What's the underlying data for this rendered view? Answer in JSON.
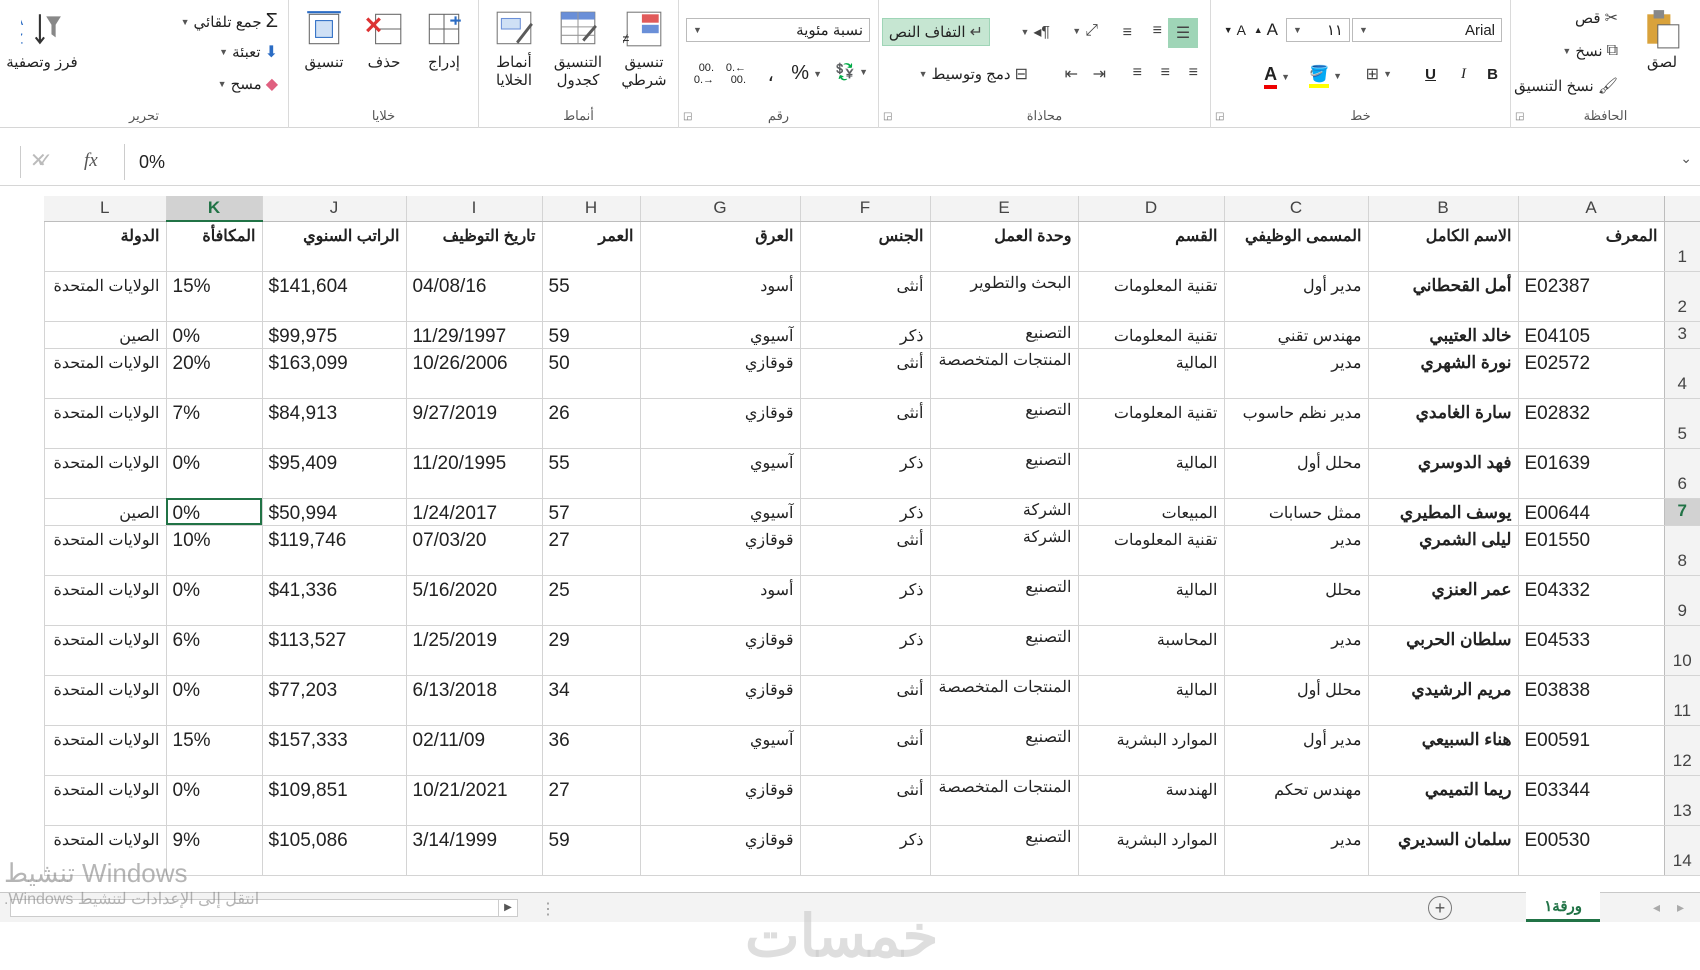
{
  "ribbon": {
    "clipboard": {
      "paste": "لصق",
      "cut": "قص",
      "copy": "نسخ",
      "format_painter": "نسخ التنسيق",
      "title": "الحافظة"
    },
    "font": {
      "name": "Arial",
      "size": "١١",
      "title": "خط",
      "bold": "B",
      "italic": "I",
      "underline": "U",
      "font_color_letter": "A"
    },
    "alignment": {
      "wrap_text": "التفاف النص",
      "merge_center": "دمج وتوسيط",
      "title": "محاذاة"
    },
    "number": {
      "format": "نسبة مئوية",
      "percent": "%",
      "comma": "،",
      "title": "رقم"
    },
    "styles": {
      "conditional": "تنسيق شرطي",
      "format_table": "التنسيق كجدول",
      "cell_styles": "أنماط الخلايا",
      "title": "أنماط"
    },
    "cells": {
      "insert": "إدراج",
      "delete": "حذف",
      "format": "تنسيق",
      "title": "خلايا"
    },
    "editing": {
      "autosum": "جمع تلقائي",
      "fill": "تعبئة",
      "clear": "مسح",
      "sort_filter": "فرز وتصفية",
      "title": "تحرير"
    }
  },
  "formula_bar": {
    "value": "0%",
    "fx": "fx"
  },
  "columns": [
    "A",
    "B",
    "C",
    "D",
    "E",
    "F",
    "G",
    "H",
    "I",
    "J",
    "K",
    "L"
  ],
  "selected_column": "K",
  "selected_row": 7,
  "headers": [
    "المعرف",
    "الاسم الكامل",
    "المسمى الوظيفي",
    "القسم",
    "وحدة العمل",
    "الجنس",
    "العرق",
    "العمر",
    "تاريخ التوظيف",
    "الراتب السنوي",
    "المكافأة",
    "الدولة"
  ],
  "rows": [
    {
      "num": "2",
      "cells": [
        "E02387",
        "أمل القحطاني",
        "مدير أول",
        "تقنية المعلومات",
        "البحث والتطوير",
        "أنثى",
        "أسود",
        "55",
        "04/08/16",
        "$141,604",
        "15%",
        "الولايات المتحدة"
      ]
    },
    {
      "num": "3",
      "cells": [
        "E04105",
        "خالد العتيبي",
        "مهندس تقني",
        "تقنية المعلومات",
        "التصنيع",
        "ذكر",
        "آسيوي",
        "59",
        "11/29/1997",
        "$99,975",
        "0%",
        "الصين"
      ]
    },
    {
      "num": "4",
      "cells": [
        "E02572",
        "نورة الشهري",
        "مدير",
        "المالية",
        "المنتجات المتخصصة",
        "أنثى",
        "قوقازي",
        "50",
        "10/26/2006",
        "$163,099",
        "20%",
        "الولايات المتحدة"
      ]
    },
    {
      "num": "5",
      "cells": [
        "E02832",
        "سارة الغامدي",
        "مدير نظم حاسوب",
        "تقنية المعلومات",
        "التصنيع",
        "أنثى",
        "قوقازي",
        "26",
        "9/27/2019",
        "$84,913",
        "7%",
        "الولايات المتحدة"
      ]
    },
    {
      "num": "6",
      "cells": [
        "E01639",
        "فهد الدوسري",
        "محلل أول",
        "المالية",
        "التصنيع",
        "ذكر",
        "آسيوي",
        "55",
        "11/20/1995",
        "$95,409",
        "0%",
        "الولايات المتحدة"
      ]
    },
    {
      "num": "7",
      "cells": [
        "E00644",
        "يوسف المطيري",
        "ممثل حسابات",
        "المبيعات",
        "الشركة",
        "ذكر",
        "آسيوي",
        "57",
        "1/24/2017",
        "$50,994",
        "0%",
        "الصين"
      ]
    },
    {
      "num": "8",
      "cells": [
        "E01550",
        "ليلى الشمري",
        "مدير",
        "تقنية المعلومات",
        "الشركة",
        "أنثى",
        "قوقازي",
        "27",
        "07/03/20",
        "$119,746",
        "10%",
        "الولايات المتحدة"
      ]
    },
    {
      "num": "9",
      "cells": [
        "E04332",
        "عمر العنزي",
        "محلل",
        "المالية",
        "التصنيع",
        "ذكر",
        "أسود",
        "25",
        "5/16/2020",
        "$41,336",
        "0%",
        "الولايات المتحدة"
      ]
    },
    {
      "num": "10",
      "cells": [
        "E04533",
        "سلطان الحربي",
        "مدير",
        "المحاسبة",
        "التصنيع",
        "ذكر",
        "قوقازي",
        "29",
        "1/25/2019",
        "$113,527",
        "6%",
        "الولايات المتحدة"
      ]
    },
    {
      "num": "11",
      "cells": [
        "E03838",
        "مريم الرشيدي",
        "محلل أول",
        "المالية",
        "المنتجات المتخصصة",
        "أنثى",
        "قوقازي",
        "34",
        "6/13/2018",
        "$77,203",
        "0%",
        "الولايات المتحدة"
      ]
    },
    {
      "num": "12",
      "cells": [
        "E00591",
        "هناء السبيعي",
        "مدير أول",
        "الموارد البشرية",
        "التصنيع",
        "أنثى",
        "آسيوي",
        "36",
        "02/11/09",
        "$157,333",
        "15%",
        "الولايات المتحدة"
      ]
    },
    {
      "num": "13",
      "cells": [
        "E03344",
        "ريما التميمي",
        "مهندس تحكم",
        "الهندسة",
        "المنتجات المتخصصة",
        "أنثى",
        "قوقازي",
        "27",
        "10/21/2021",
        "$109,851",
        "0%",
        "الولايات المتحدة"
      ]
    },
    {
      "num": "14",
      "cells": [
        "E00530",
        "سلمان السديري",
        "مدير",
        "الموارد البشرية",
        "التصنيع",
        "ذكر",
        "قوقازي",
        "59",
        "3/14/1999",
        "$105,086",
        "9%",
        "الولايات المتحدة"
      ]
    }
  ],
  "sheet_tab": "ورقة١",
  "watermark": {
    "line1": "تنشيط Windows",
    "line2": "انتقل إلى الإعدادات لتنشيط Windows."
  },
  "brand": "خمسات",
  "colors": {
    "accent": "#217346"
  }
}
